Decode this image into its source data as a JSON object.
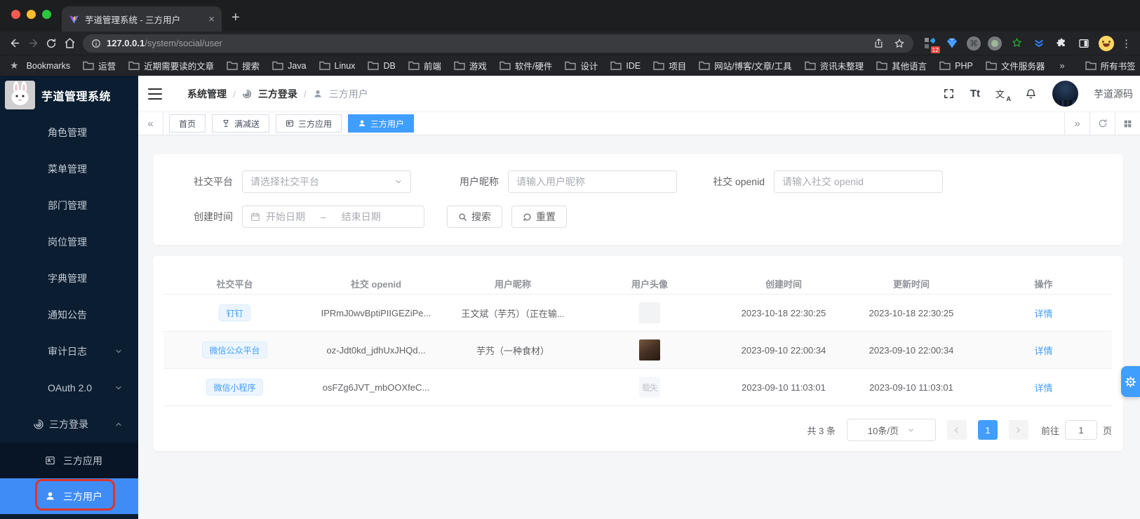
{
  "browser": {
    "tab_title": "芋道管理系统 - 三方用户",
    "close_glyph": "×",
    "new_tab_glyph": "+",
    "url_host": "127.0.0.1",
    "url_path": "/system/social/user",
    "ext_badge": "12",
    "bookmarks_label": "Bookmarks",
    "folders": [
      "运营",
      "近期需要读的文章",
      "搜索",
      "Java",
      "Linux",
      "DB",
      "前端",
      "游戏",
      "软件/硬件",
      "设计",
      "IDE",
      "项目",
      "网站/博客/文章/工具",
      "资讯未整理",
      "其他语言",
      "PHP",
      "文件服务器"
    ],
    "overflow_glyph": "»",
    "all_bookmarks": "所有书签"
  },
  "sidebar": {
    "title": "芋道管理系统",
    "items": [
      "角色管理",
      "菜单管理",
      "部门管理",
      "岗位管理",
      "字典管理",
      "通知公告",
      "审计日志",
      "OAuth 2.0",
      "三方登录"
    ],
    "sub": [
      "三方应用",
      "三方用户"
    ]
  },
  "header": {
    "breadcrumb": [
      "系统管理",
      "三方登录",
      "三方用户"
    ],
    "sep": "/",
    "font_tool": "Tt",
    "lang_zh": "文",
    "lang_a": "A",
    "username": "芋道源码"
  },
  "tags": {
    "collapse": "«",
    "items": [
      "首页",
      "满减送",
      "三方应用",
      "三方用户"
    ],
    "expand": "»"
  },
  "form": {
    "platform_label": "社交平台",
    "platform_placeholder": "请选择社交平台",
    "nickname_label": "用户昵称",
    "nickname_placeholder": "请输入用户昵称",
    "openid_label": "社交 openid",
    "openid_placeholder": "请输入社交 openid",
    "time_label": "创建时间",
    "start_placeholder": "开始日期",
    "range_sep": "–",
    "end_placeholder": "结束日期",
    "search_label": "搜索",
    "reset_label": "重置"
  },
  "table": {
    "columns": [
      "社交平台",
      "社交 openid",
      "用户昵称",
      "用户头像",
      "创建时间",
      "更新时间",
      "操作"
    ],
    "rows": [
      {
        "platform": "钉钉",
        "openid": "IPRmJ0wvBptiPIIGEZiPe...",
        "nickname": "王文斌（芋艿）（正在输...",
        "created": "2023-10-18 22:30:25",
        "updated": "2023-10-18 22:30:25",
        "action": "详情"
      },
      {
        "platform": "微信公众平台",
        "openid": "oz-Jdt0kd_jdhUxJHQd...",
        "nickname": "芋艿（一种食材）",
        "created": "2023-09-10 22:00:34",
        "updated": "2023-09-10 22:00:34",
        "action": "详情"
      },
      {
        "platform": "微信小程序",
        "openid": "osFZg6JVT_mbOOXfeC...",
        "nickname": "",
        "avatar_alt": "载失",
        "created": "2023-09-10 11:03:01",
        "updated": "2023-09-10 11:03:01",
        "action": "详情"
      }
    ]
  },
  "pagination": {
    "total": "共 3 条",
    "size": "10条/页",
    "page": "1",
    "goto": "前往",
    "goto_value": "1",
    "unit": "页"
  },
  "colors": {
    "primary": "#409eff",
    "sidebar_bg": "#0b1d30",
    "annotation": "#e0342b"
  }
}
